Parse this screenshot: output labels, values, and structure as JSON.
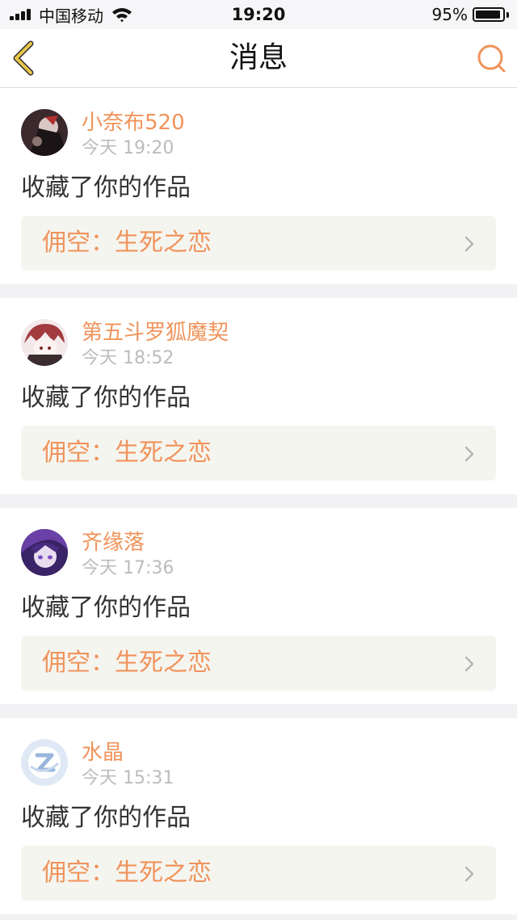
{
  "status_bar": {
    "carrier": "中国移动",
    "time": "19:20",
    "battery": "95%",
    "battery_level": 0.95
  },
  "nav": {
    "title": "消息",
    "back_icon": "chevron-left-icon",
    "search_icon": "search-icon"
  },
  "colors": {
    "accent": "#f0935b",
    "back_icon": "#e8c64a",
    "timestamp": "#bcbcbc",
    "link_bg": "#f5f5f0"
  },
  "messages": [
    {
      "username": "小奈布520",
      "time": "今天 19:20",
      "action": "收藏了你的作品",
      "work": "佣空：生死之恋",
      "avatar": "avatar-dark"
    },
    {
      "username": "第五斗罗狐魔契",
      "time": "今天 18:52",
      "action": "收藏了你的作品",
      "work": "佣空：生死之恋",
      "avatar": "avatar-red"
    },
    {
      "username": "齐缘落",
      "time": "今天 17:36",
      "action": "收藏了你的作品",
      "work": "佣空：生死之恋",
      "avatar": "avatar-purple"
    },
    {
      "username": "水晶",
      "time": "今天 15:31",
      "action": "收藏了你的作品",
      "work": "佣空：生死之恋",
      "avatar": "avatar-default"
    }
  ]
}
